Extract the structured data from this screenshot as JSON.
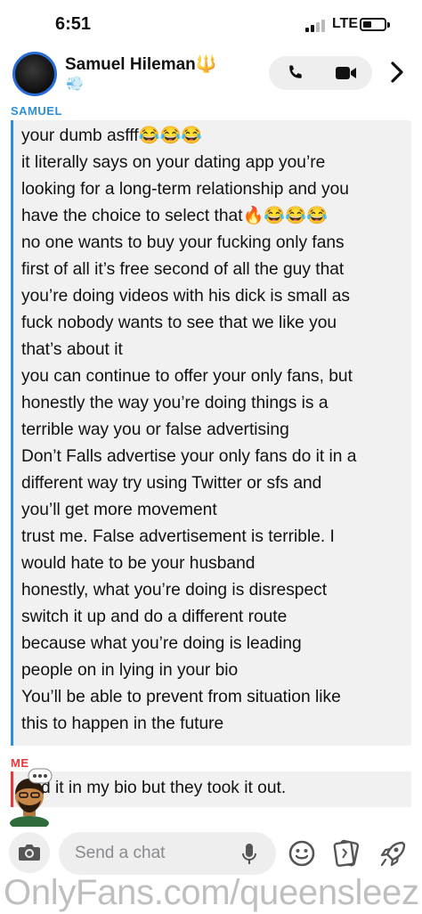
{
  "status_bar": {
    "time": "6:51",
    "network": "LTE"
  },
  "header": {
    "contact_name": "Samuel Hileman",
    "name_emoji": "🔱",
    "status_emoji": "💨"
  },
  "conversation": {
    "their_label": "SAMUEL",
    "their_lines": [
      "your dumb asfff😂😂😂",
      "it literally says on your dating app you’re",
      "looking for a long-term relationship and you",
      "have the choice to select that🔥😂😂😂",
      "no one wants to buy your fucking only fans",
      "first of all it’s free second of all the guy that",
      "you’re doing videos with his dick is small as",
      "fuck nobody wants to see that we like you",
      "that’s about it",
      "you can continue to offer your only fans, but",
      "honestly the way you’re doing things is a",
      "terrible way you or false advertising",
      "Don’t Falls advertise your only fans do it in a",
      "different way try using Twitter or sfs  and",
      "you’ll get more movement",
      "trust me. False advertisement is terrible. I",
      "would hate to be your husband",
      "honestly, what you’re doing is disrespect",
      "switch it up and do a different route",
      "because what you’re doing is leading",
      "people on in lying in your bio",
      "You’ll be able to prevent from situation like",
      "this to happen in the future"
    ],
    "my_label": "ME",
    "my_message": "d it in my bio but they took it out."
  },
  "input": {
    "placeholder": "Send a chat"
  },
  "watermark": "OnlyFans.com/queensleez",
  "colors": {
    "their_accent": "#2e8fd9",
    "my_accent": "#e63a3a",
    "avatar_ring": "#2a6cd6",
    "bubble_bg": "#f1f1f1"
  },
  "icons": [
    "phone-icon",
    "video-camera-icon",
    "chevron-right-icon",
    "camera-icon",
    "microphone-icon",
    "smiley-icon",
    "sticker-icon",
    "rocket-icon",
    "bitmoji-avatar"
  ]
}
